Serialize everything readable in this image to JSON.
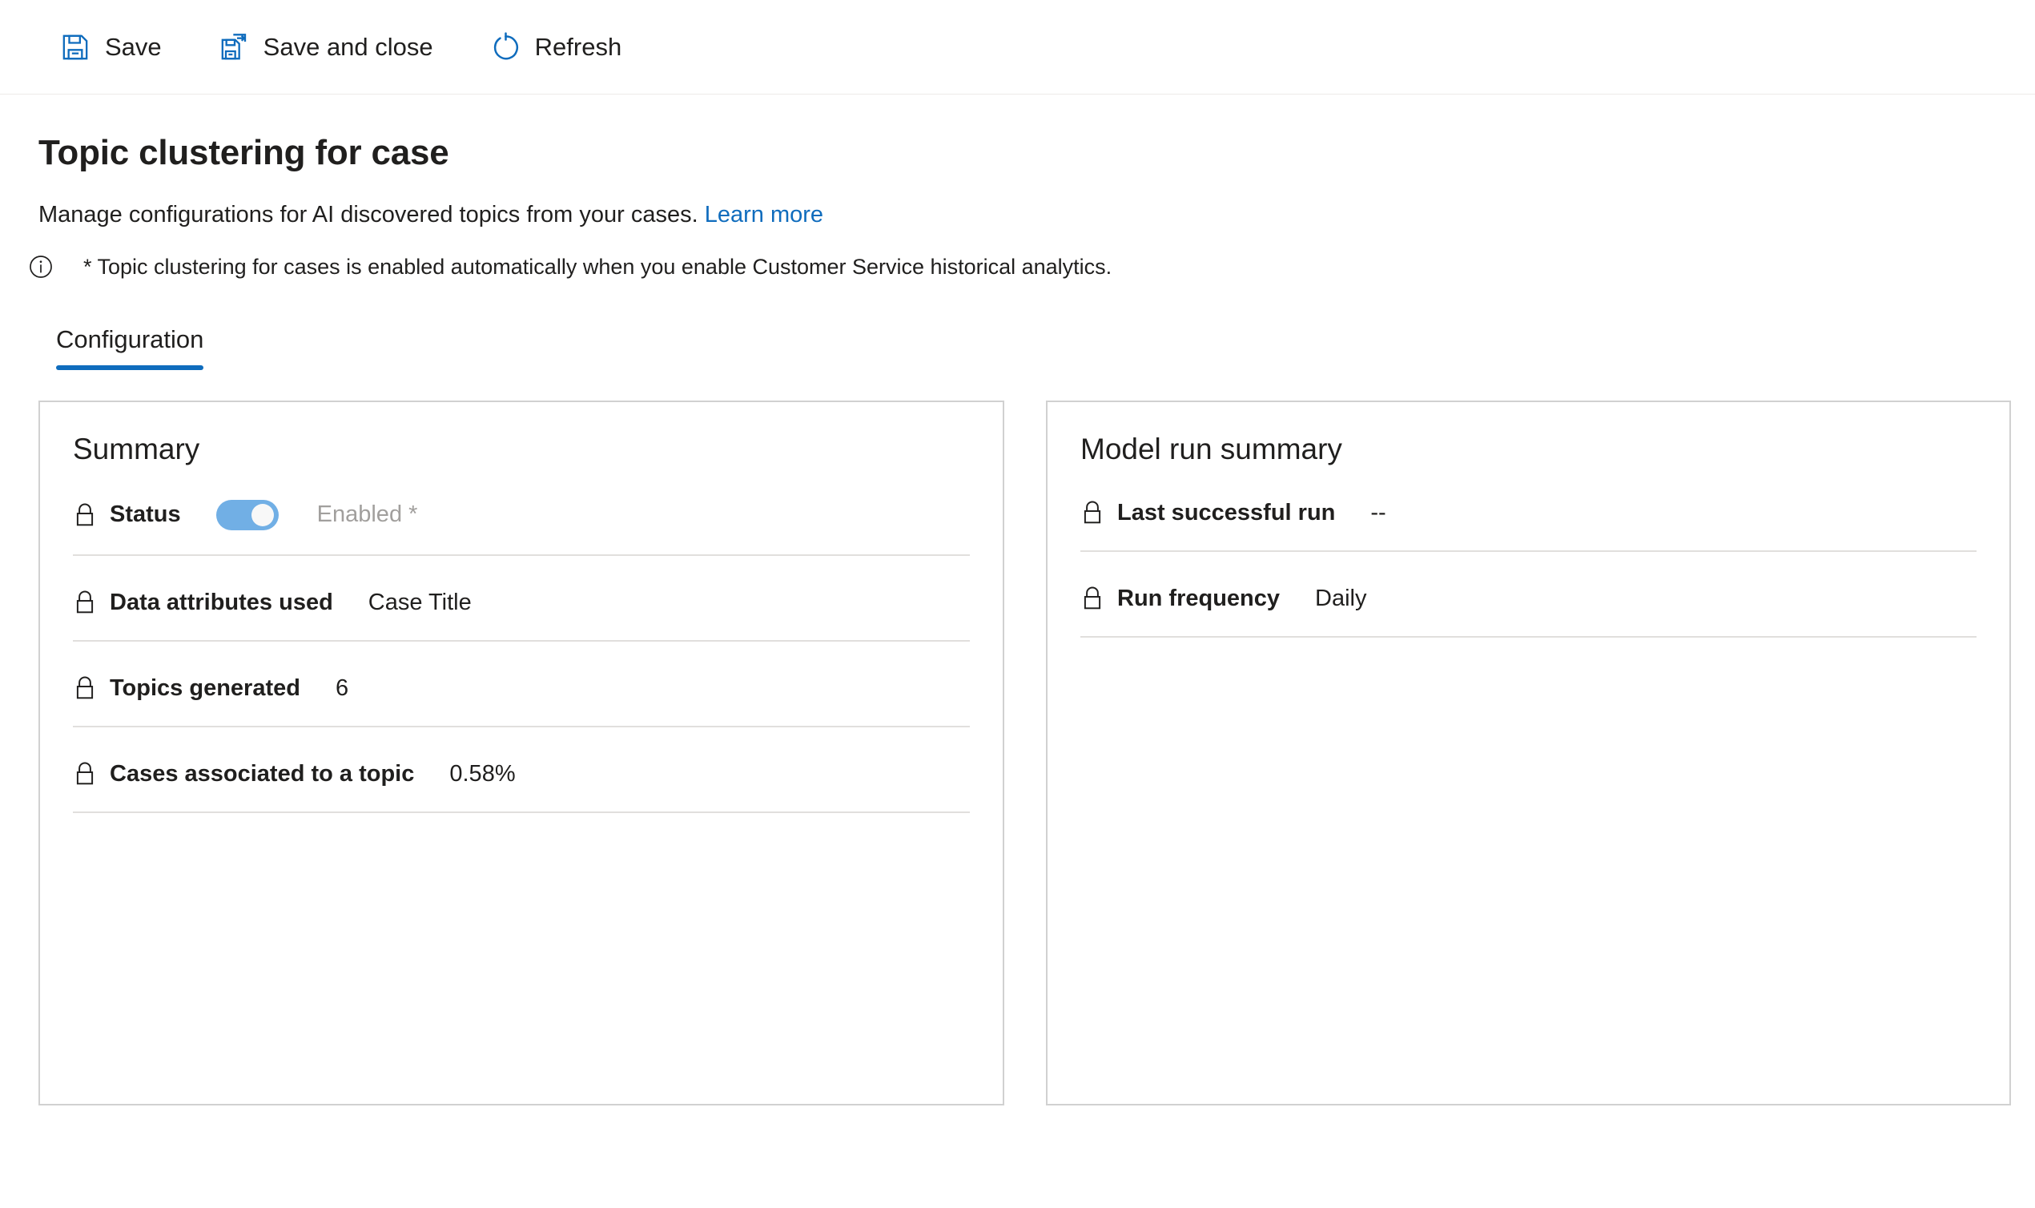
{
  "command_bar": {
    "buttons": [
      {
        "label": "Save",
        "icon": "save-icon"
      },
      {
        "label": "Save and close",
        "icon": "save-and-close-icon"
      },
      {
        "label": "Refresh",
        "icon": "refresh-icon"
      }
    ]
  },
  "header": {
    "title": "Topic clustering for case",
    "subtitle_text": "Manage configurations for AI discovered topics from your cases.",
    "learn_more_label": "Learn more",
    "info_icon": "info-circle-icon",
    "info_note": "* Topic clustering for cases is enabled automatically when you enable Customer Service historical analytics."
  },
  "tabs": [
    {
      "label": "Configuration",
      "active": true
    }
  ],
  "summary_card": {
    "title": "Summary",
    "rows": [
      {
        "icon": "lock-icon",
        "label": "Status",
        "control": "toggle",
        "toggle_on": true,
        "value": "Enabled *"
      },
      {
        "icon": "lock-icon",
        "label": "Data attributes used",
        "value": "Case Title"
      },
      {
        "icon": "lock-icon",
        "label": "Topics generated",
        "value": "6"
      },
      {
        "icon": "lock-icon",
        "label": "Cases associated to a topic",
        "value": "0.58%"
      }
    ]
  },
  "model_run_card": {
    "title": "Model run summary",
    "rows": [
      {
        "icon": "lock-icon",
        "label": "Last successful run",
        "value": "--"
      },
      {
        "icon": "lock-icon",
        "label": "Run frequency",
        "value": "Daily"
      }
    ]
  },
  "colors": {
    "accent": "#0f6cbd",
    "toggle_on": "#71afe5",
    "card_border": "#d1d1d1",
    "rule": "#e1dfdd",
    "dim_text": "#a19f9d"
  }
}
